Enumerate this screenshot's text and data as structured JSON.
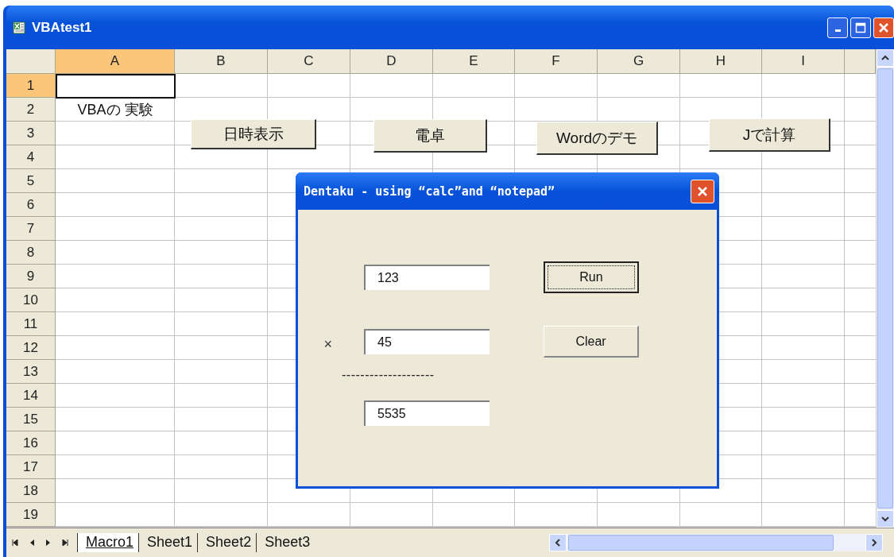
{
  "window": {
    "title": "VBAtest1"
  },
  "columns": [
    {
      "label": "A",
      "selected": true
    },
    {
      "label": "B",
      "selected": false
    },
    {
      "label": "C",
      "selected": false
    },
    {
      "label": "D",
      "selected": false
    },
    {
      "label": "E",
      "selected": false
    },
    {
      "label": "F",
      "selected": false
    },
    {
      "label": "G",
      "selected": false
    },
    {
      "label": "H",
      "selected": false
    },
    {
      "label": "I",
      "selected": false
    }
  ],
  "rows": [
    {
      "label": "1",
      "selected": true
    },
    {
      "label": "2",
      "selected": false,
      "column_a": "VBAの 実験"
    },
    {
      "label": "3",
      "selected": false
    },
    {
      "label": "4",
      "selected": false
    },
    {
      "label": "5",
      "selected": false
    },
    {
      "label": "6",
      "selected": false
    },
    {
      "label": "7",
      "selected": false
    },
    {
      "label": "8",
      "selected": false
    },
    {
      "label": "9",
      "selected": false
    },
    {
      "label": "10",
      "selected": false
    },
    {
      "label": "11",
      "selected": false
    },
    {
      "label": "12",
      "selected": false
    },
    {
      "label": "13",
      "selected": false
    },
    {
      "label": "14",
      "selected": false
    },
    {
      "label": "15",
      "selected": false
    },
    {
      "label": "16",
      "selected": false
    },
    {
      "label": "17",
      "selected": false
    },
    {
      "label": "18",
      "selected": false
    },
    {
      "label": "19",
      "selected": false
    }
  ],
  "sheet_buttons": [
    "日時表示",
    "電卓",
    "Wordのデモ",
    "Jで計算"
  ],
  "dialog": {
    "title": "Dentaku - using “calc”and “notepad”",
    "operand_1": "123",
    "operator": "×",
    "operand_2": "45",
    "separator": "--------------------",
    "result": "5535",
    "buttons": [
      {
        "label": "Run",
        "focused": true
      },
      {
        "label": "Clear",
        "focused": false
      }
    ]
  },
  "sheet_tabs": [
    {
      "label": "Macro1",
      "selected": true
    },
    {
      "label": "Sheet1",
      "selected": false
    },
    {
      "label": "Sheet2",
      "selected": false
    },
    {
      "label": "Sheet3",
      "selected": false
    }
  ]
}
